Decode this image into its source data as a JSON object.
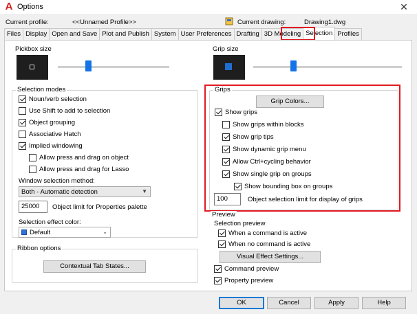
{
  "window": {
    "title": "Options",
    "app_icon": "A",
    "close_glyph": "✕"
  },
  "profile": {
    "label": "Current profile:",
    "value": "<<Unnamed Profile>>"
  },
  "drawing": {
    "label": "Current drawing:",
    "value": "Drawing1.dwg"
  },
  "tabs": [
    "Files",
    "Display",
    "Open and Save",
    "Plot and Publish",
    "System",
    "User Preferences",
    "Drafting",
    "3D Modeling",
    "Selection",
    "Profiles"
  ],
  "active_tab": "Selection",
  "pickbox": {
    "label": "Pickbox size",
    "level": 0.27
  },
  "grip_size": {
    "label": "Grip size",
    "level": 0.27
  },
  "selection_modes": {
    "label": "Selection modes",
    "items": [
      {
        "label": "Noun/verb selection",
        "checked": true
      },
      {
        "label": "Use Shift to add to selection",
        "checked": false
      },
      {
        "label": "Object grouping",
        "checked": true
      },
      {
        "label": "Associative Hatch",
        "checked": false
      },
      {
        "label": "Implied windowing",
        "checked": true
      },
      {
        "label": "Allow press and drag on object",
        "checked": false
      },
      {
        "label": "Allow press and drag for Lasso",
        "checked": false
      }
    ],
    "window_method_label": "Window selection method:",
    "window_method_value": "Both - Automatic detection",
    "object_limit_value": "25000",
    "object_limit_label": "Object limit for Properties palette",
    "effect_color_label": "Selection effect color:",
    "effect_color_value": "Default",
    "effect_color_swatch": "#2f6fd6"
  },
  "ribbon": {
    "label": "Ribbon options",
    "button": "Contextual Tab States..."
  },
  "grips": {
    "label": "Grips",
    "colors_button": "Grip Colors...",
    "items": [
      {
        "label": "Show grips",
        "checked": true
      },
      {
        "label": "Show grips within blocks",
        "checked": false
      },
      {
        "label": "Show grip tips",
        "checked": true
      },
      {
        "label": "Show dynamic grip menu",
        "checked": true
      },
      {
        "label": "Allow Ctrl+cycling behavior",
        "checked": true
      },
      {
        "label": "Show single grip on groups",
        "checked": true
      },
      {
        "label": "Show bounding box on groups",
        "checked": true
      }
    ],
    "limit_value": "100",
    "limit_label": "Object selection limit for display of grips"
  },
  "preview": {
    "label": "Preview",
    "selection_preview_label": "Selection preview",
    "items": [
      {
        "label": "When a command is active",
        "checked": true
      },
      {
        "label": "When no command is active",
        "checked": true
      }
    ],
    "visual_effect_button": "Visual Effect Settings...",
    "command_preview": {
      "label": "Command preview",
      "checked": true
    },
    "property_preview": {
      "label": "Property preview",
      "checked": true
    }
  },
  "footer": {
    "ok": "OK",
    "cancel": "Cancel",
    "apply": "Apply",
    "help": "Help"
  },
  "colors": {
    "highlight_red": "#e11a22",
    "accent_blue": "#1473e6"
  }
}
